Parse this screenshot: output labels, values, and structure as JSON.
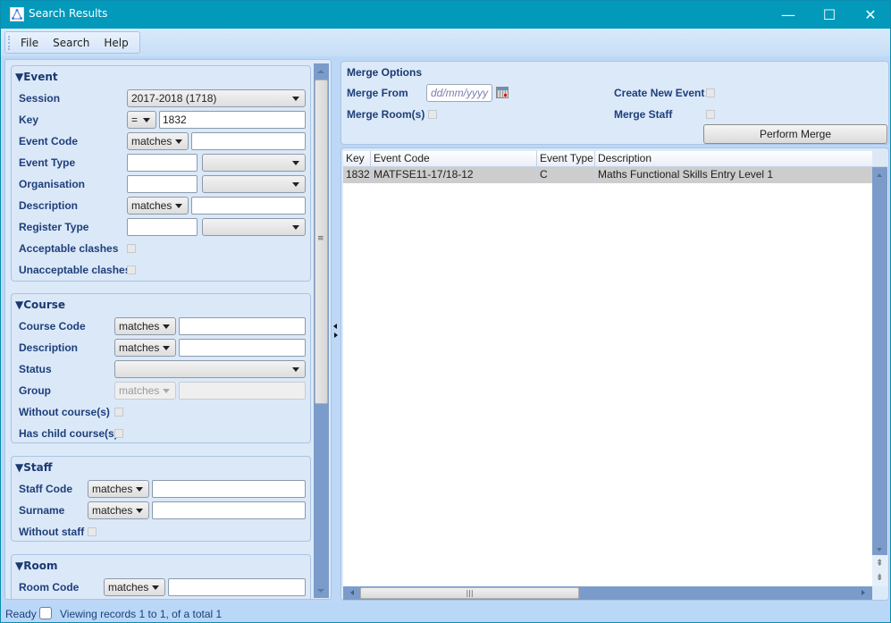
{
  "window": {
    "title": "Search Results",
    "controls": {
      "minimize": "—",
      "maximize": "☐",
      "close": "✕"
    }
  },
  "menu": [
    "File",
    "Search",
    "Help"
  ],
  "event": {
    "title": "▼Event",
    "session_label": "Session",
    "session_value": "2017-2018 (1718)",
    "key_label": "Key",
    "key_operator": "=",
    "key_value": "1832",
    "event_code_label": "Event Code",
    "event_code_operator": "matches",
    "event_code_value": "",
    "event_type_label": "Event Type",
    "event_type_value": "",
    "event_type_select": "",
    "organisation_label": "Organisation",
    "organisation_value": "",
    "organisation_select": "",
    "description_label": "Description",
    "description_operator": "matches",
    "description_value": "",
    "register_type_label": "Register Type",
    "register_type_value": "",
    "register_type_select": "",
    "acceptable_clashes_label": "Acceptable clashes",
    "acceptable_clashes_checked": false,
    "unacceptable_clashes_label": "Unacceptable clashes",
    "unacceptable_clashes_checked": false
  },
  "course": {
    "title": "▼Course",
    "course_code_label": "Course Code",
    "course_code_operator": "matches",
    "course_code_value": "",
    "description_label": "Description",
    "description_operator": "matches",
    "description_value": "",
    "status_label": "Status",
    "status_value": "",
    "group_label": "Group",
    "group_operator": "matches",
    "group_value": "",
    "without_courses_label": "Without course(s)",
    "without_courses_checked": false,
    "has_child_label": "Has child course(s)",
    "has_child_checked": false
  },
  "staff": {
    "title": "▼Staff",
    "staff_code_label": "Staff Code",
    "staff_code_operator": "matches",
    "staff_code_value": "",
    "surname_label": "Surname",
    "surname_operator": "matches",
    "surname_value": "",
    "without_staff_label": "Without staff",
    "without_staff_checked": false
  },
  "room": {
    "title": "▼Room",
    "room_code_label": "Room Code",
    "room_code_operator": "matches",
    "room_code_value": ""
  },
  "merge": {
    "title": "Merge Options",
    "merge_from_label": "Merge From",
    "merge_from_placeholder": "dd/mm/yyyy",
    "merge_rooms_label": "Merge Room(s)",
    "merge_rooms_checked": false,
    "create_new_event_label": "Create New Event",
    "create_new_event_checked": false,
    "merge_staff_label": "Merge Staff",
    "merge_staff_checked": false,
    "perform_button": "Perform Merge"
  },
  "results": {
    "columns": [
      "Key",
      "Event Code",
      "Event Type",
      "Description"
    ],
    "rows": [
      [
        "1832",
        "MATFSE11-17/18-12",
        "C",
        "Maths Functional Skills Entry Level 1"
      ]
    ]
  },
  "status": {
    "state": "Ready",
    "message": "Viewing records 1 to 1, of a total 1"
  }
}
